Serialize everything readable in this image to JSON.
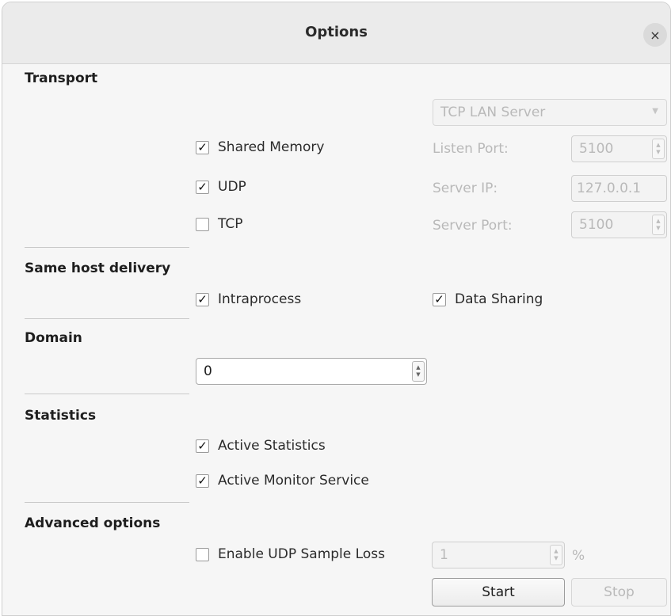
{
  "window": {
    "title": "Options",
    "close_glyph": "×"
  },
  "transport": {
    "heading": "Transport",
    "shared_memory": {
      "label": "Shared Memory",
      "checked": true
    },
    "udp": {
      "label": "UDP",
      "checked": true
    },
    "tcp": {
      "label": "TCP",
      "checked": false
    },
    "tcp_mode_select": {
      "value": "TCP LAN Server",
      "enabled": false
    },
    "listen_port": {
      "label": "Listen Port:",
      "value": "5100"
    },
    "server_ip": {
      "label": "Server IP:",
      "value": "127.0.0.1"
    },
    "server_port": {
      "label": "Server Port:",
      "value": "5100"
    }
  },
  "same_host_delivery": {
    "heading": "Same host delivery",
    "intraprocess": {
      "label": "Intraprocess",
      "checked": true
    },
    "data_sharing": {
      "label": "Data Sharing",
      "checked": true
    }
  },
  "domain": {
    "heading": "Domain",
    "value": "0"
  },
  "statistics": {
    "heading": "Statistics",
    "active_statistics": {
      "label": "Active Statistics",
      "checked": true
    },
    "active_monitor_service": {
      "label": "Active Monitor Service",
      "checked": true
    }
  },
  "advanced": {
    "heading": "Advanced options",
    "udp_sample_loss": {
      "label": "Enable UDP Sample Loss",
      "checked": false
    },
    "loss_value": "1",
    "loss_unit": "%"
  },
  "buttons": {
    "start": "Start",
    "stop": "Stop"
  },
  "glyphs": {
    "check": "✓",
    "spin_up": "▲",
    "spin_down": "▼",
    "combo_arrow": "▼"
  },
  "icons": {
    "close": "close-icon",
    "check": "check-icon",
    "spin": "spin-arrows-icon",
    "dropdown": "chevron-down-icon"
  }
}
